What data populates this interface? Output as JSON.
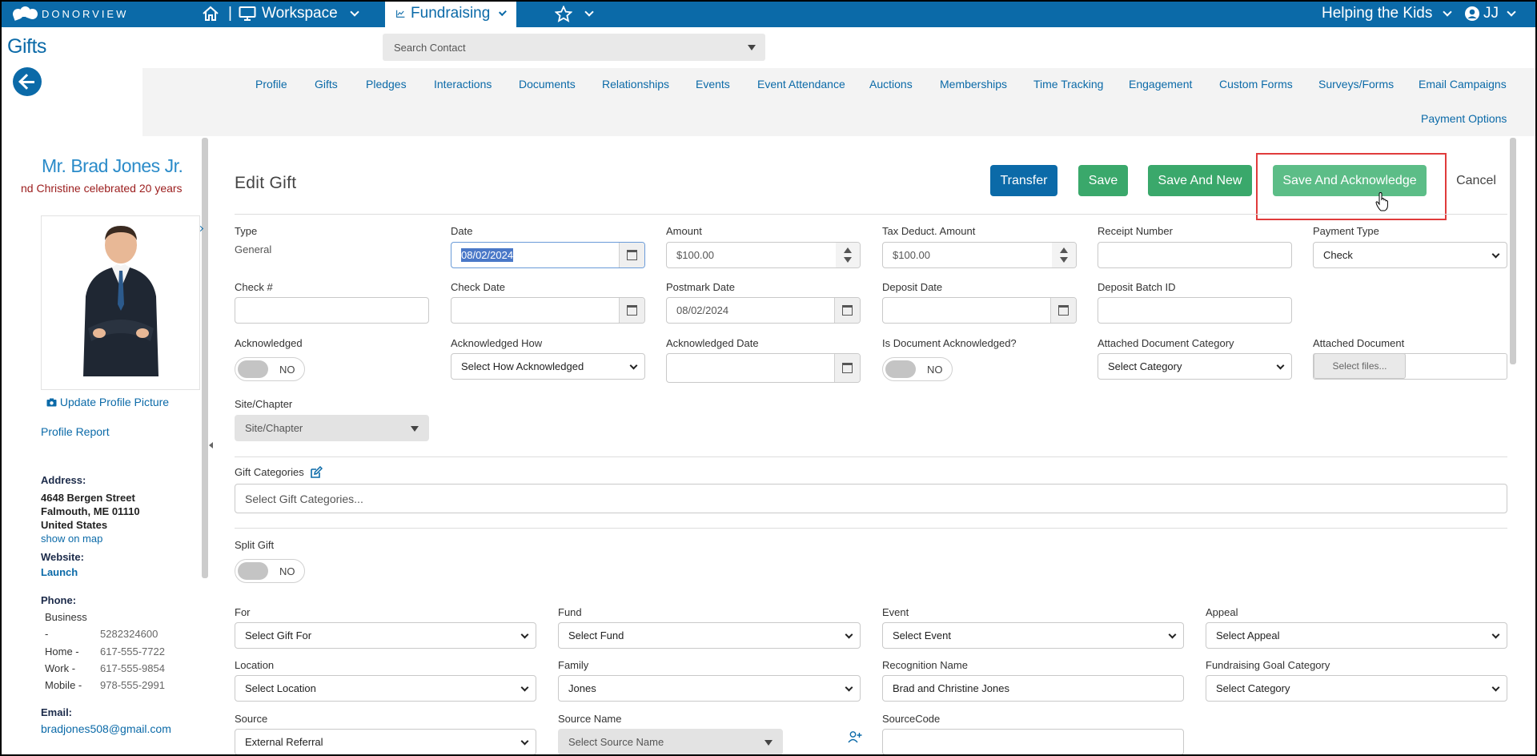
{
  "topbar": {
    "logo_text": "DONORVIEW",
    "workspace_label": "Workspace",
    "fundraising_label": "Fundraising",
    "separator": "|",
    "org_label": "Helping the Kids",
    "user_initials": "JJ",
    "colors": {
      "bar": "#0b6aa8"
    }
  },
  "page": {
    "title": "Gifts",
    "search_placeholder": "Search Contact"
  },
  "tabs": [
    "Profile",
    "Gifts",
    "Pledges",
    "Interactions",
    "Documents",
    "Relationships",
    "Events",
    "Event Attendance",
    "Auctions",
    "Memberships",
    "Time Tracking",
    "Engagement",
    "Custom Forms",
    "Surveys/Forms",
    "Email Campaigns",
    "Payment Options"
  ],
  "sidebar": {
    "name": "Mr. Brad Jones Jr.",
    "note": "nd Christine celebrated 20 years",
    "update_picture": "Update Profile Picture",
    "profile_report": "Profile Report",
    "address_label": "Address:",
    "address_line1": "4648 Bergen Street",
    "address_line2": "Falmouth, ME 01110",
    "address_line3": "United States",
    "show_on_map": "show on map",
    "website_label": "Website:",
    "website_link": "Launch",
    "phone_label": "Phone:",
    "phones": [
      {
        "type": "Business",
        "sep": "-",
        "number": "5282324600"
      },
      {
        "type": "Home -",
        "number": "617-555-7722"
      },
      {
        "type": "Work -",
        "number": "617-555-9854"
      },
      {
        "type": "Mobile -",
        "number": "978-555-2991"
      }
    ],
    "email_label": "Email:",
    "email": "bradjones508@gmail.com"
  },
  "form": {
    "title": "Edit Gift",
    "buttons": {
      "transfer": "Transfer",
      "save": "Save",
      "save_and_new": "Save And New",
      "save_and_acknowledge": "Save And Acknowledge",
      "cancel": "Cancel"
    },
    "type_label": "Type",
    "type_value": "General",
    "date_label": "Date",
    "date_value": "08/02/2024",
    "amount_label": "Amount",
    "amount_value": "$100.00",
    "tax_label": "Tax Deduct. Amount",
    "tax_value": "$100.00",
    "receipt_label": "Receipt Number",
    "payment_type_label": "Payment Type",
    "payment_type_value": "Check",
    "check_no_label": "Check #",
    "check_date_label": "Check Date",
    "postmark_label": "Postmark Date",
    "postmark_value": "08/02/2024",
    "deposit_date_label": "Deposit Date",
    "deposit_batch_label": "Deposit Batch ID",
    "acknowledged_label": "Acknowledged",
    "acknowledged_value": "NO",
    "ack_how_label": "Acknowledged How",
    "ack_how_value": "Select How Acknowledged",
    "ack_date_label": "Acknowledged Date",
    "doc_ack_label": "Is Document Acknowledged?",
    "doc_ack_value": "NO",
    "doc_category_label": "Attached Document Category",
    "doc_category_value": "Select Category",
    "attached_doc_label": "Attached Document",
    "select_files": "Select files...",
    "site_label": "Site/Chapter",
    "site_value": "Site/Chapter",
    "gift_categories_label": "Gift Categories",
    "gift_categories_placeholder": "Select Gift Categories...",
    "split_gift_label": "Split Gift",
    "split_gift_value": "NO",
    "for_label": "For",
    "for_value": "Select Gift For",
    "fund_label": "Fund",
    "fund_value": "Select Fund",
    "event_label": "Event",
    "event_value": "Select Event",
    "appeal_label": "Appeal",
    "appeal_value": "Select Appeal",
    "location_label": "Location",
    "location_value": "Select Location",
    "family_label": "Family",
    "family_value": "Jones",
    "recognition_label": "Recognition Name",
    "recognition_value": "Brad and Christine Jones",
    "goal_category_label": "Fundraising Goal Category",
    "goal_category_value": "Select Category",
    "source_label": "Source",
    "source_value": "External Referral",
    "source_name_label": "Source Name",
    "source_name_value": "Select Source Name",
    "sourcecode_label": "SourceCode"
  }
}
